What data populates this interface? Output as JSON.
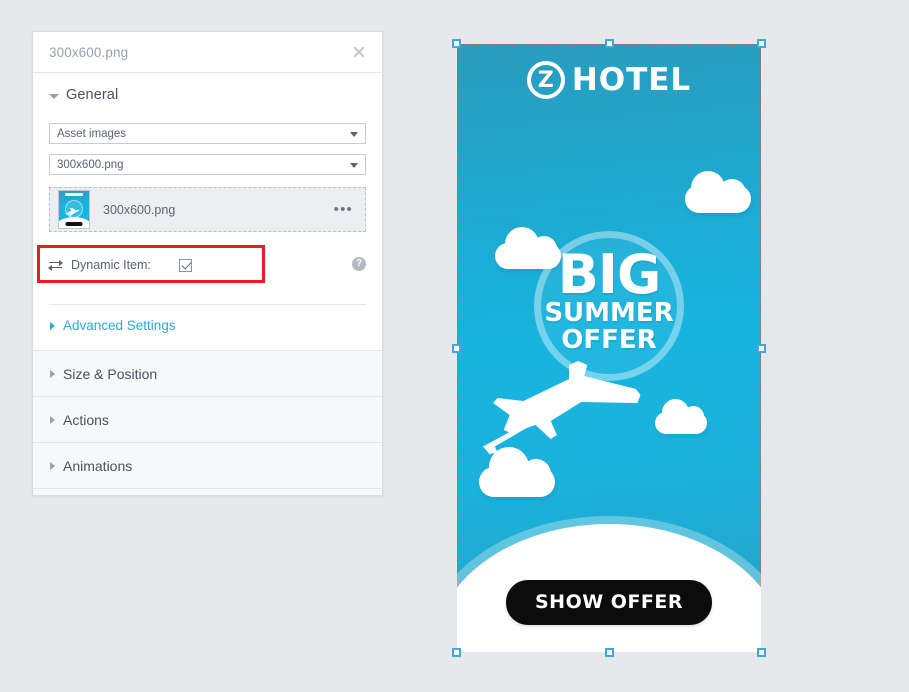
{
  "theme": {
    "page_background": "#e6e8ec",
    "panel_background": "#ffffff",
    "link_accent": "#2ba8e0",
    "highlight_outline": "#ee1c1c",
    "selection_handle": "#3fa9d8",
    "banner_top": "#2a9cbd",
    "banner_mid": "#17b4e0",
    "banner_bottom": "#25a0c2",
    "cta_background": "#0c0c0c"
  },
  "panel": {
    "title": "300x600.png",
    "close_label": "×",
    "general": {
      "heading": "General",
      "source_select": {
        "value": "Asset images",
        "placeholder": "Asset images"
      },
      "file_select": {
        "value": "300x600.png",
        "placeholder": "300x600.png"
      },
      "asset": {
        "name": "300x600.png",
        "menu_label": "•••"
      },
      "dynamic_item": {
        "label": "Dynamic Item:",
        "checked": true,
        "help_label": "?"
      },
      "advanced_settings": "Advanced Settings"
    },
    "sections": [
      {
        "label": "Size & Position"
      },
      {
        "label": "Actions"
      },
      {
        "label": "Animations"
      }
    ]
  },
  "banner": {
    "logo": {
      "mark": "Z",
      "text": "HOTEL"
    },
    "headline_1": "BIG",
    "headline_2": "SUMMER",
    "headline_3": "OFFER",
    "cta_label": "SHOW OFFER"
  }
}
